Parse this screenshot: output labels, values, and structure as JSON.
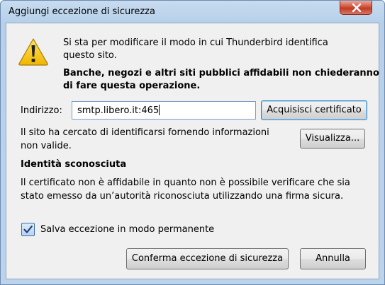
{
  "window": {
    "title": "Aggiungi eccezione di sicurezza"
  },
  "icons": {
    "warning": "warning-icon",
    "close": "close-icon",
    "check": "check-icon"
  },
  "intro": {
    "line1": "Si sta per modificare il modo in cui Thunderbird identifica",
    "line2": "questo sito.",
    "bold_line1": "Banche, negozi e altri siti pubblici affidabili non chiederanno",
    "bold_line2": "di fare questa operazione."
  },
  "address": {
    "label": "Indirizzo:",
    "value": "smtp.libero.it:465",
    "get_cert_button": "Acquisisci certificato"
  },
  "status": {
    "line1": "Il sito ha cercato di identificarsi fornendo informazioni",
    "line2": "non valide.",
    "view_button": "Visualizza..."
  },
  "identity": {
    "heading": "Identità sconosciuta",
    "line1": "Il certificato non è affidabile in quanto non è possibile verificare che sia",
    "line2": "stato emesso da un’autorità riconosciuta utilizzando una firma sicura."
  },
  "permanent": {
    "label": "Salva eccezione in modo permanente",
    "checked": true
  },
  "buttons": {
    "confirm": "Conferma eccezione di sicurezza",
    "cancel": "Annulla"
  },
  "colors": {
    "titlebar": "#b7d0ea",
    "close_button": "#c23a23",
    "dialog_bg": "#f0f0f0",
    "focus_border": "#3c7fb1"
  }
}
